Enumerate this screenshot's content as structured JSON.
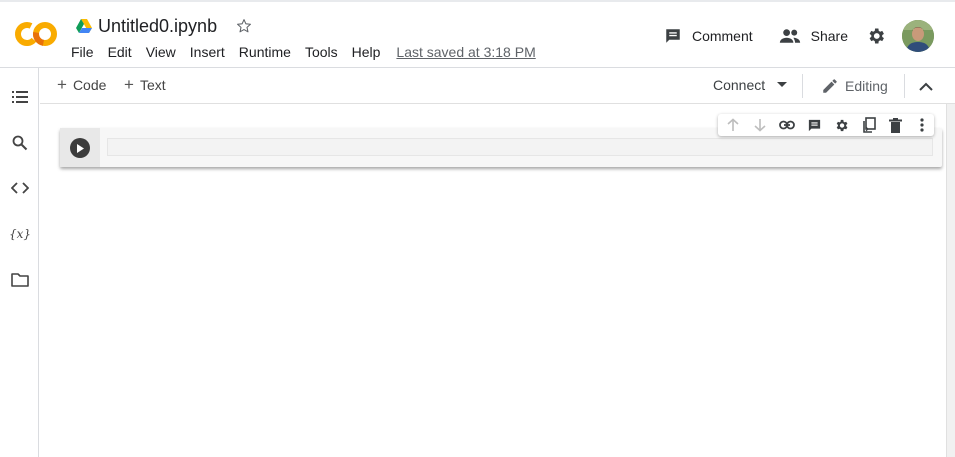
{
  "app": {
    "doc_title": "Untitled0.ipynb",
    "last_saved": "Last saved at 3:18 PM"
  },
  "menu": {
    "items": [
      "File",
      "Edit",
      "View",
      "Insert",
      "Runtime",
      "Tools",
      "Help"
    ]
  },
  "header": {
    "comment_label": "Comment",
    "share_label": "Share"
  },
  "toolbar": {
    "add_code_label": "Code",
    "add_text_label": "Text",
    "connect_label": "Connect",
    "editing_label": "Editing"
  },
  "left_rail": {
    "icons": [
      "table-of-contents-icon",
      "search-icon",
      "code-snippets-icon",
      "variables-icon",
      "files-icon"
    ],
    "variables_glyph": "{x}"
  },
  "cell": {
    "code": ""
  },
  "cell_toolbar": {
    "icons": [
      "move-up-icon",
      "move-down-icon",
      "link-icon",
      "comment-icon",
      "settings-icon",
      "mirror-cell-icon",
      "delete-icon",
      "more-vert-icon"
    ]
  },
  "colors": {
    "colab_orange": "#f9ab00",
    "colab_dark_orange": "#e8710a",
    "icon_gray": "#5f6368",
    "dark_icon": "#3c4043"
  }
}
